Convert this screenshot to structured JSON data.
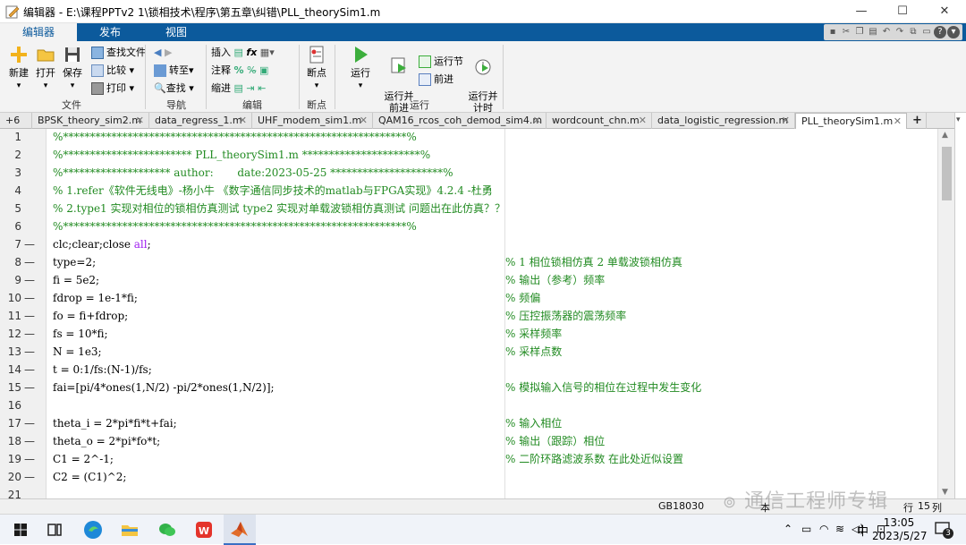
{
  "window": {
    "title": "编辑器 - E:\\课程PPTv2 1\\锁相技术\\程序\\第五章\\纠错\\PLL_theorySim1.m",
    "minimize": "—",
    "maximize": "☐",
    "close": "✕"
  },
  "ribbon_tabs": [
    "编辑器",
    "发布",
    "视图"
  ],
  "ribbon": {
    "groups": {
      "file": "文件",
      "navigate": "导航",
      "edit": "编辑",
      "breakpoints": "断点",
      "run": "运行"
    },
    "new_label": "新建",
    "open_label": "打开",
    "save_label": "保存",
    "find_files": "查找文件",
    "compare": "比较",
    "print": "打印",
    "goto": "转至",
    "find": "查找",
    "insert": "插入",
    "comment": "注释",
    "indent": "缩进",
    "breakpoints_label": "断点",
    "run_label": "运行",
    "run_advance": "运行并\n前进",
    "run_section": "运行节",
    "advance": "前进",
    "run_time": "运行并\n计时"
  },
  "doc_tabs": {
    "overflow": "+6",
    "items": [
      "BPSK_theory_sim2.m",
      "data_regress_1.m",
      "UHF_modem_sim1.m",
      "QAM16_rcos_coh_demod_sim4.m",
      "wordcount_chn.m",
      "data_logistic_regression.m",
      "PLL_theorySim1.m"
    ],
    "add": "+"
  },
  "code_lines": [
    {
      "n": "1",
      "dash": "",
      "code": "%****************************************************************%",
      "cls": "cm",
      "rc": ""
    },
    {
      "n": "2",
      "dash": "",
      "code": "%************************ PLL_theorySim1.m **********************%",
      "cls": "cm",
      "rc": ""
    },
    {
      "n": "3",
      "dash": "",
      "code": "%******************** author:       date:2023-05-25 *********************%",
      "cls": "cm",
      "rc": ""
    },
    {
      "n": "4",
      "dash": "",
      "code": "% 1.refer《软件无线电》-杨小牛 《数字通信同步技术的matlab与FPGA实现》4.2.4 -杜勇",
      "cls": "cm",
      "rc": ""
    },
    {
      "n": "5",
      "dash": "",
      "code": "% 2.type1 实现对相位的锁相仿真测试 type2 实现对单载波锁相仿真测试 问题出在此仿真？？",
      "cls": "cm",
      "rc": ""
    },
    {
      "n": "6",
      "dash": "",
      "code": "%****************************************************************%",
      "cls": "cm",
      "rc": ""
    },
    {
      "n": "7",
      "dash": "—",
      "code": "clc;clear;close ",
      "kw": "all",
      "tail": ";",
      "cls": "",
      "rc": ""
    },
    {
      "n": "8",
      "dash": "—",
      "code": "type=2;",
      "cls": "",
      "rc": "% 1 相位锁相仿真 2 单载波锁相仿真"
    },
    {
      "n": "9",
      "dash": "—",
      "code": "fi = 5e2;",
      "cls": "",
      "rc": "% 输出（参考）频率"
    },
    {
      "n": "10",
      "dash": "—",
      "code": "fdrop = 1e-1*fi;",
      "cls": "",
      "rc": "% 频偏"
    },
    {
      "n": "11",
      "dash": "—",
      "code": "fo = fi+fdrop;",
      "cls": "",
      "rc": "% 压控振荡器的震荡频率"
    },
    {
      "n": "12",
      "dash": "—",
      "code": "fs = 10*fi;",
      "cls": "",
      "rc": "% 采样频率"
    },
    {
      "n": "13",
      "dash": "—",
      "code": "N = 1e3;",
      "cls": "",
      "rc": "% 采样点数"
    },
    {
      "n": "14",
      "dash": "—",
      "code": "t = 0:1/fs:(N-1)/fs;",
      "cls": "",
      "rc": ""
    },
    {
      "n": "15",
      "dash": "—",
      "code": "fai=[pi/4*ones(1,N/2) -pi/2*ones(1,N/2)];",
      "cls": "",
      "rc": "% 模拟输入信号的相位在过程中发生变化"
    },
    {
      "n": "16",
      "dash": "",
      "code": "",
      "cls": "",
      "rc": ""
    },
    {
      "n": "17",
      "dash": "—",
      "code": "theta_i = 2*pi*fi*t+fai;",
      "cls": "",
      "rc": "% 输入相位"
    },
    {
      "n": "18",
      "dash": "—",
      "code": "theta_o = 2*pi*fo*t;",
      "cls": "",
      "rc": "% 输出（跟踪）相位"
    },
    {
      "n": "19",
      "dash": "—",
      "code": "C1 = 2^-1;",
      "cls": "",
      "rc": "% 二阶环路滤波系数 在此处近似设置"
    },
    {
      "n": "20",
      "dash": "—",
      "code": "C2 = (C1)^2;",
      "cls": "",
      "rc": ""
    },
    {
      "n": "21",
      "dash": "",
      "code": "",
      "cls": "",
      "rc": ""
    }
  ],
  "status": {
    "encoding": "GB18030",
    "mode": "本",
    "row_label": "行",
    "row": "15",
    "col_label": "列"
  },
  "watermark": "通信工程师专辑",
  "taskbar": {
    "ime": "中",
    "time": "13:05",
    "date": "2023/5/27",
    "notifications": "3"
  }
}
